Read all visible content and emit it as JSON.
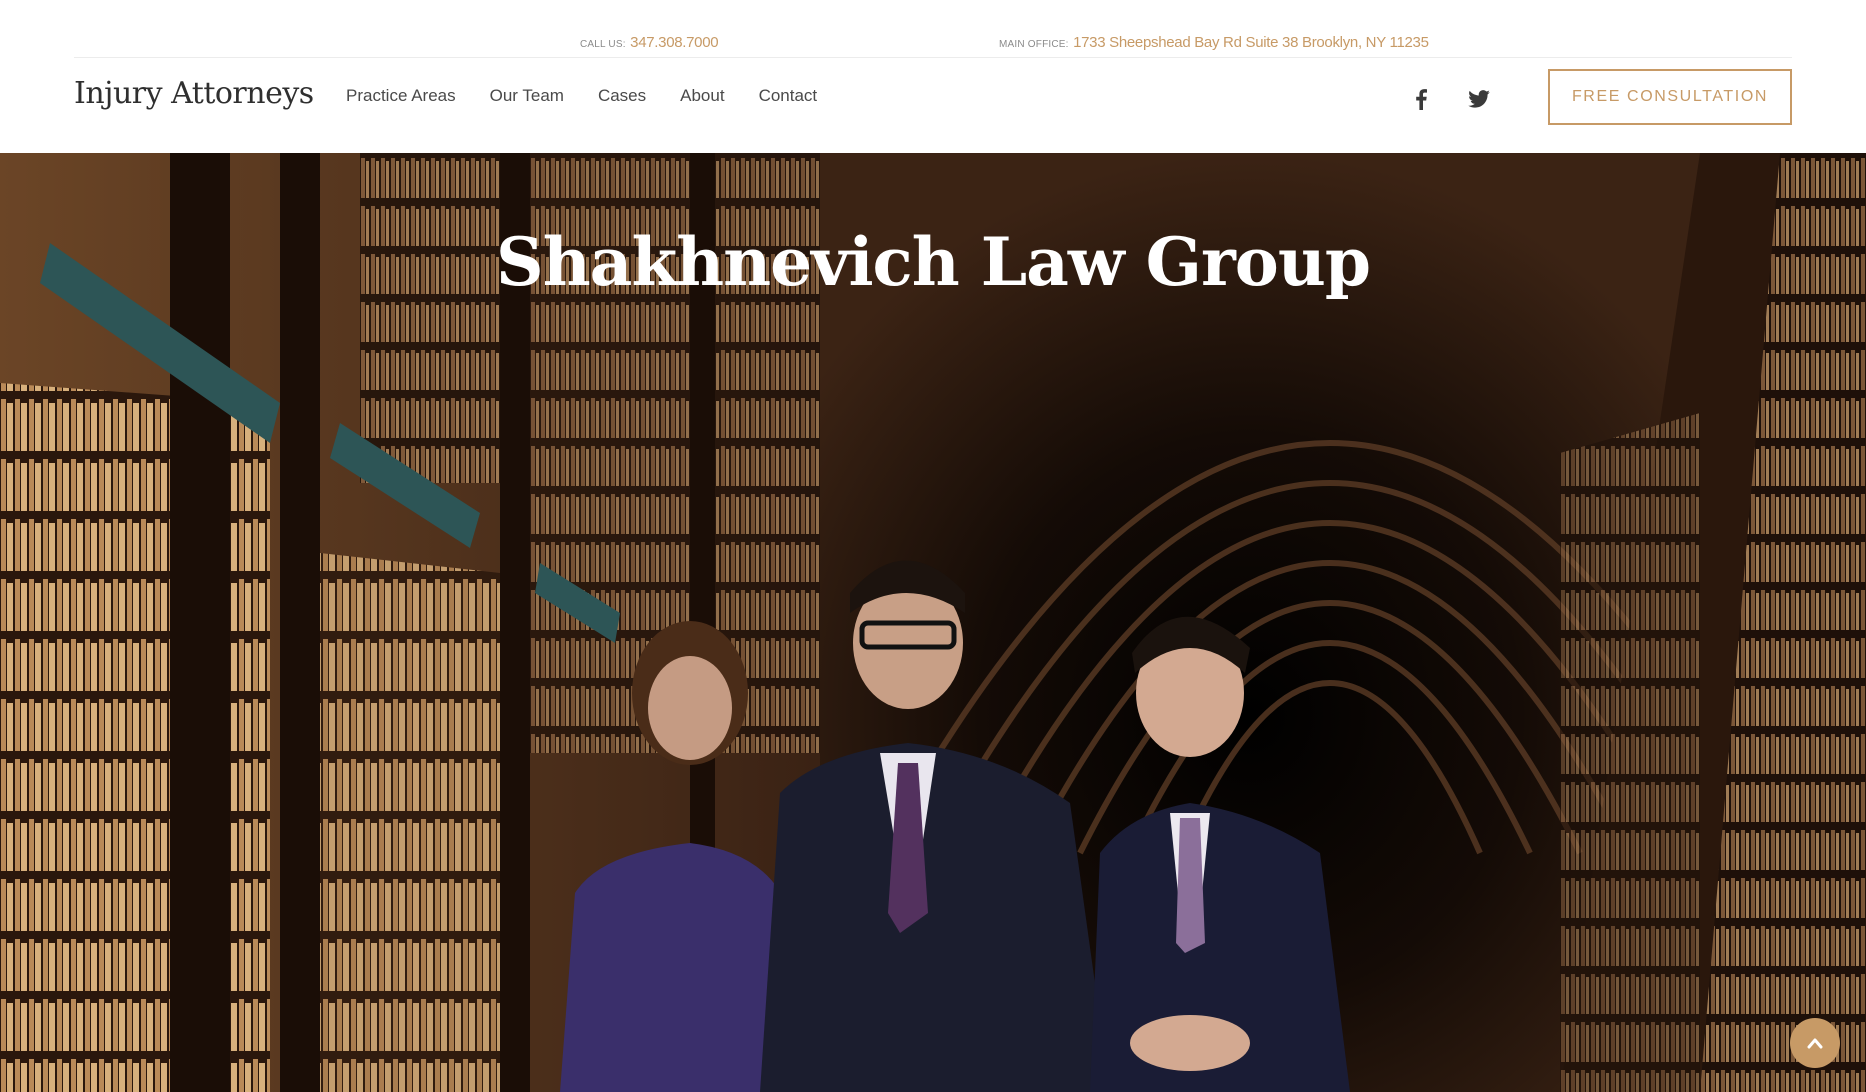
{
  "topbar": {
    "phone_label": "CALL US:",
    "phone_value": "347.308.7000",
    "office_label": "MAIN OFFICE:",
    "office_value": "1733 Sheepshead Bay Rd Suite 38 Brooklyn, NY 11235"
  },
  "header": {
    "logo": "Injury Attorneys",
    "nav": [
      "Practice Areas",
      "Our Team",
      "Cases",
      "About",
      "Contact"
    ],
    "social": [
      "facebook-icon",
      "twitter-icon"
    ],
    "cta_label": "FREE CONSULTATION"
  },
  "hero": {
    "title": "Shakhnevich Law Group",
    "image": "attorneys-in-library-photo"
  },
  "scroll_top": {
    "icon": "chevron-up-icon"
  },
  "colors": {
    "accent": "#c79a66",
    "text_dark": "#2f2f2f",
    "hero_text": "#ffffff"
  }
}
